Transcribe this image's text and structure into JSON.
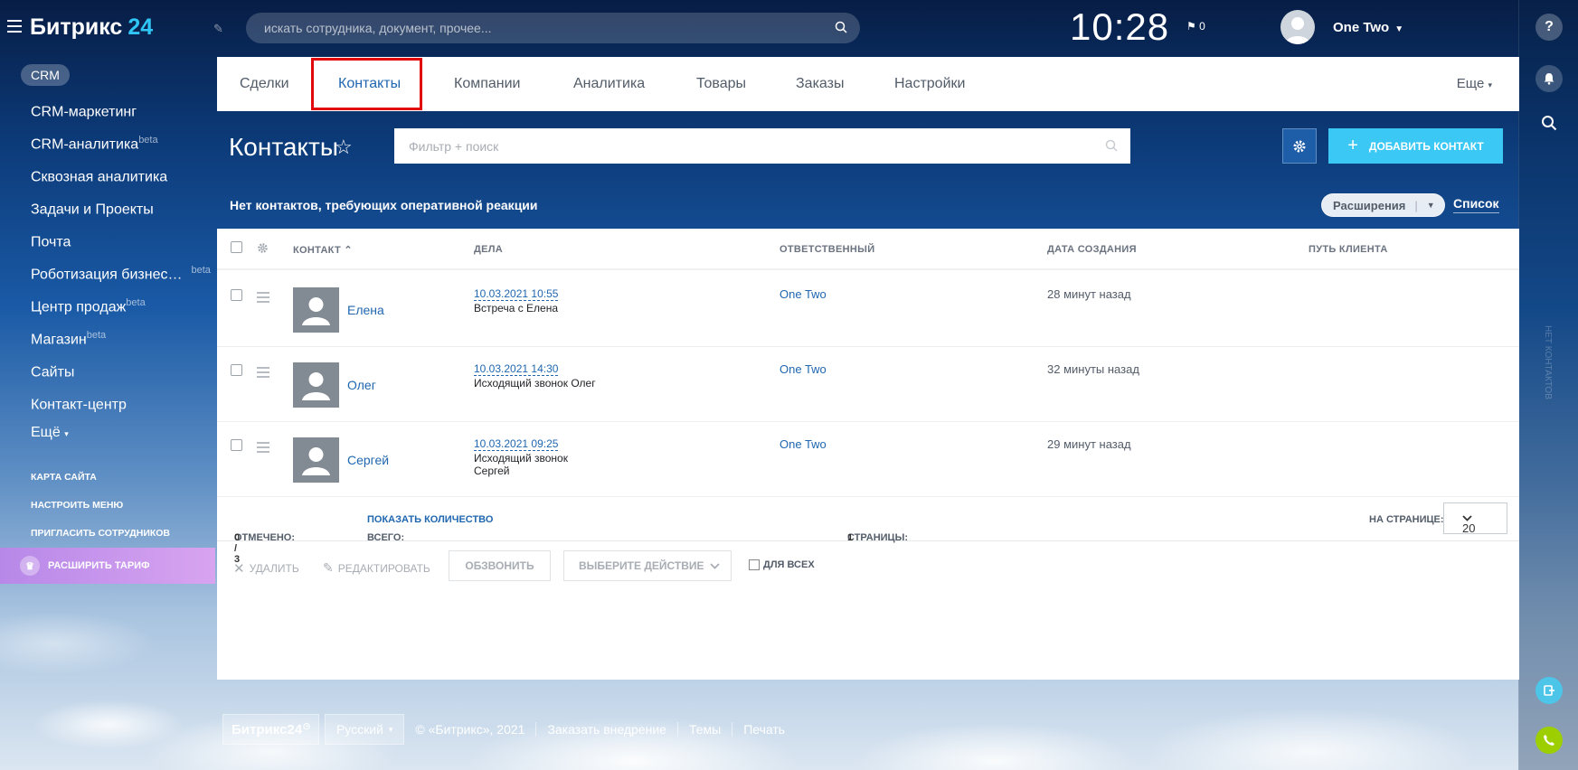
{
  "app": {
    "logo_text": "Битрикс",
    "logo_num": "24"
  },
  "header": {
    "search_placeholder": "искать сотрудника, документ, прочее...",
    "clock": "10:28",
    "flag_count": "0",
    "user_name": "One Two"
  },
  "sidebar": {
    "active_label": "CRM",
    "items": [
      {
        "label": "CRM-маркетинг",
        "badge": ""
      },
      {
        "label": "CRM-аналитика",
        "badge": "beta"
      },
      {
        "label": "Сквозная аналитика",
        "badge": ""
      },
      {
        "label": "Задачи и Проекты",
        "badge": ""
      },
      {
        "label": "Почта",
        "badge": ""
      },
      {
        "label": "Роботизация бизнес…",
        "badge": "beta"
      },
      {
        "label": "Центр продаж",
        "badge": "beta"
      },
      {
        "label": "Магазин",
        "badge": "beta"
      },
      {
        "label": "Сайты",
        "badge": ""
      },
      {
        "label": "Контакт-центр",
        "badge": ""
      },
      {
        "label": "Ещё",
        "badge": ""
      }
    ],
    "links": [
      "КАРТА САЙТА",
      "НАСТРОИТЬ МЕНЮ",
      "ПРИГЛАСИТЬ СОТРУДНИКОВ"
    ],
    "tariff_label": "РАСШИРИТЬ ТАРИФ"
  },
  "tabs": [
    "Сделки",
    "Контакты",
    "Компании",
    "Аналитика",
    "Товары",
    "Заказы",
    "Настройки"
  ],
  "active_tab": "Контакты",
  "more_label": "Еще",
  "page": {
    "title": "Контакты",
    "filter_placeholder": "Фильтр + поиск",
    "add_label": "ДОБАВИТЬ КОНТАКТ",
    "notice": "Нет контактов, требующих оперативной реакции",
    "extensions_label": "Расширения",
    "list_label": "Список"
  },
  "table": {
    "columns": [
      "КОНТАКТ",
      "ДЕЛА",
      "ОТВЕТСТВЕННЫЙ",
      "ДАТА СОЗДАНИЯ",
      "ПУТЬ КЛИЕНТА"
    ],
    "rows": [
      {
        "name": "Елена",
        "deal_date": "10.03.2021 10:55",
        "deal_text": "Встреча с Елена",
        "responsible": "One Two",
        "created": "28 минут назад"
      },
      {
        "name": "Олег",
        "deal_date": "10.03.2021 14:30",
        "deal_text": "Исходящий звонок Олег",
        "responsible": "One Two",
        "created": "32 минуты назад"
      },
      {
        "name": "Сергей",
        "deal_date": "10.03.2021 09:25",
        "deal_text": "Исходящий звонок Сергей",
        "responsible": "One Two",
        "created": "29 минут назад"
      }
    ]
  },
  "grid_footer": {
    "checked_label": "ОТМЕЧЕНО:",
    "checked_value": "0 / 3",
    "total_label": "ВСЕГО:",
    "total_link": "ПОКАЗАТЬ КОЛИЧЕСТВО",
    "pages_label": "СТРАНИЦЫ:",
    "pages_value": "1",
    "per_page_label": "НА СТРАНИЦЕ:",
    "per_page_value": "20"
  },
  "actions": {
    "delete": "УДАЛИТЬ",
    "edit": "РЕДАКТИРОВАТЬ",
    "call": "ОБЗВОНИТЬ",
    "choose": "ВЫБЕРИТЕ ДЕЙСТВИЕ",
    "for_all": "ДЛЯ ВСЕХ"
  },
  "footer": {
    "brand": "Битрикс24",
    "language": "Русский",
    "copyright": "© «Битрикс», 2021",
    "links": [
      "Заказать внедрение",
      "Темы",
      "Печать"
    ]
  },
  "right_strip_text": "НЕТ КОНТАКТОВ",
  "colors": {
    "accent": "#2067b0",
    "add_button": "#3bc8f5",
    "tariff": "#c995ec",
    "highlight": "#e2070b"
  }
}
